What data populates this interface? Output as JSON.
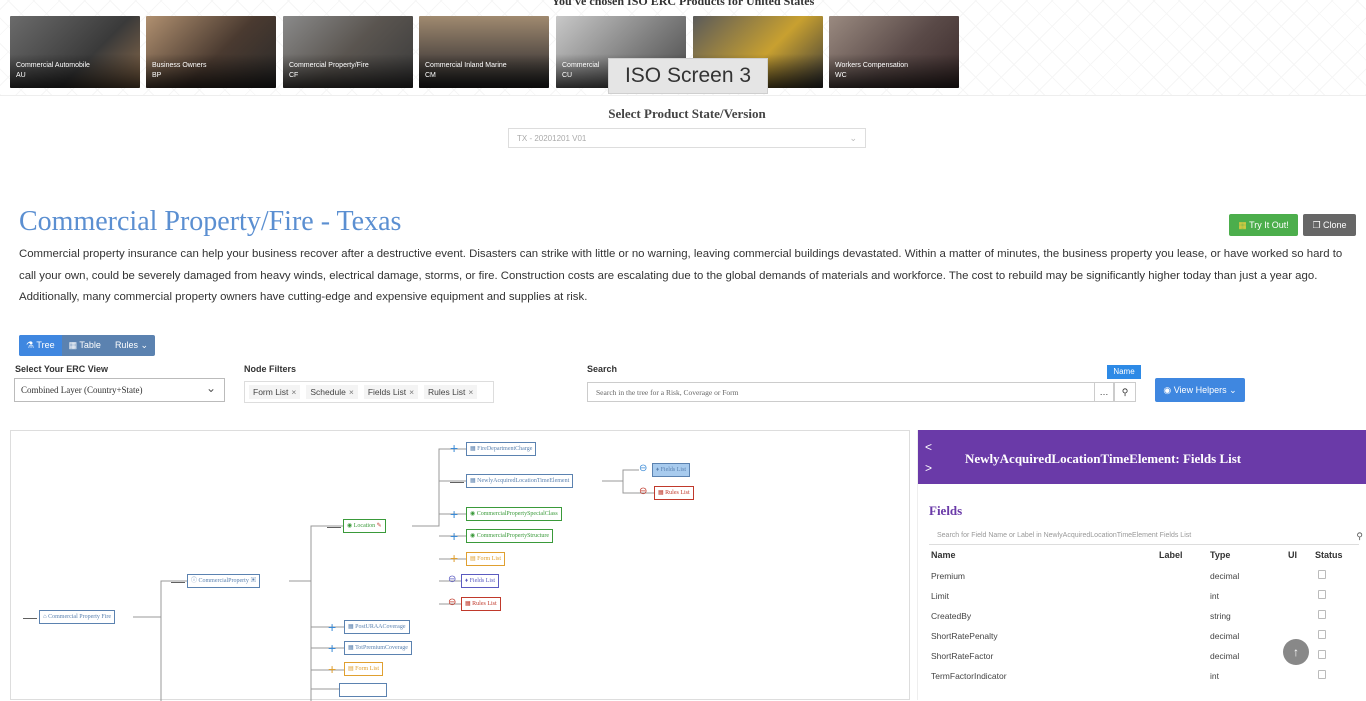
{
  "header": {
    "heading": "You've chosen ISO ERC Products for United States"
  },
  "products": [
    {
      "label": "Commercial Automobile",
      "code": "AU"
    },
    {
      "label": "Business Owners",
      "code": "BP"
    },
    {
      "label": "Commercial Property/Fire",
      "code": "CF"
    },
    {
      "label": "Commercial Inland Marine",
      "code": "CM"
    },
    {
      "label": "Commercial",
      "code": "CU"
    },
    {
      "label": "",
      "code": ""
    },
    {
      "label": "Workers Compensation",
      "code": "WC"
    }
  ],
  "tooltip": "ISO Screen 3",
  "version_select": {
    "title": "Select Product State/Version",
    "value": "TX - 20201201 V01"
  },
  "page": {
    "title": "Commercial Property/Fire - Texas",
    "try_label": "Try It Out!",
    "clone_label": "Clone",
    "description": "Commercial property insurance can help your business recover after a destructive event. Disasters can strike with little or no warning, leaving commercial buildings devastated. Within a matter of minutes, the business property you lease, or have worked so hard to call your own, could be severely damaged from heavy winds, electrical damage, storms, or fire. Construction costs are escalating due to the global demands of materials and workforce. The cost to rebuild may be significantly higher today than just a year ago. Additionally, many commercial property owners have cutting-edge and expensive equipment and supplies at risk."
  },
  "view_tabs": {
    "tree": "Tree",
    "table": "Table",
    "rules": "Rules"
  },
  "controls": {
    "erc_view_label": "Select Your ERC View",
    "erc_view_value": "Combined Layer (Country+State)",
    "node_filters_label": "Node Filters",
    "filters": [
      "Form List",
      "Schedule",
      "Fields List",
      "Rules List"
    ],
    "search_label": "Search",
    "search_placeholder": "Search in the tree for a Risk, Coverage or Form",
    "name_badge": "Name",
    "view_helpers": "View Helpers"
  },
  "tree": {
    "root": "Commercial Property Fire",
    "commercial_property": "CommercialProperty",
    "location": "Location",
    "fire_dept": "FireDepartmentCharge",
    "newly_acquired": "NewlyAcquiredLocationTimeElement",
    "fields_list": "Fields List",
    "rules_list": "Rules List",
    "special_class": "CommercialPropertySpecialClass",
    "structure": "CommercialPropertyStructure",
    "form_list": "Form List",
    "fields_list2": "Fields List",
    "rules_list2": "Rules List",
    "post_ur": "PostURAACoverage",
    "tot_premium": "TotPremiumCoverage",
    "form_list2": "Form List"
  },
  "panel": {
    "title": "NewlyAcquiredLocationTimeElement: Fields List",
    "section": "Fields",
    "search_placeholder": "Search for Field Name or Label in NewlyAcquiredLocationTimeElement Fields List",
    "columns": {
      "name": "Name",
      "label": "Label",
      "type": "Type",
      "ui": "UI",
      "status": "Status"
    },
    "rows": [
      {
        "name": "Premium",
        "type": "decimal"
      },
      {
        "name": "Limit",
        "type": "int"
      },
      {
        "name": "CreatedBy",
        "type": "string"
      },
      {
        "name": "ShortRatePenalty",
        "type": "decimal"
      },
      {
        "name": "ShortRateFactor",
        "type": "decimal"
      },
      {
        "name": "TermFactorIndicator",
        "type": "int"
      }
    ]
  },
  "colors": {
    "accent": "#5b8fd1",
    "panel": "#6a3aa8",
    "try": "#4cae4c"
  }
}
